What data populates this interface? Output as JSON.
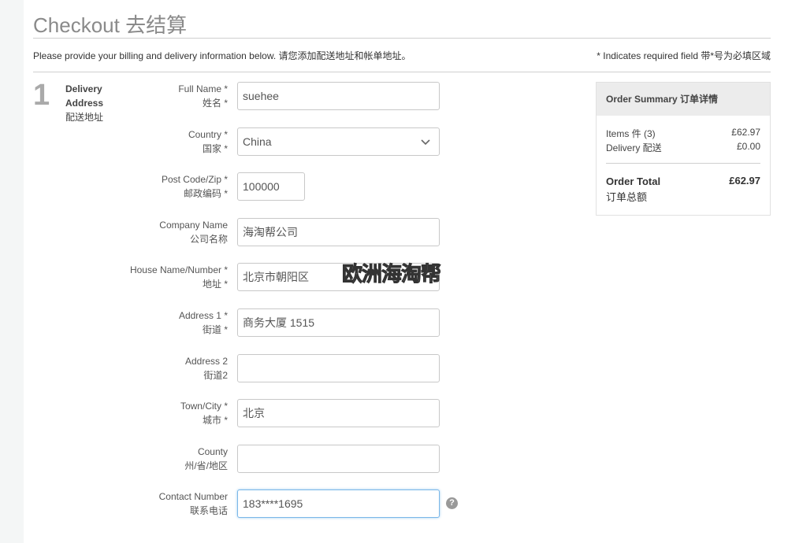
{
  "header": {
    "title": "Checkout 去结算",
    "intro": "Please provide your billing and delivery information below. 请您添加配送地址和帐单地址。",
    "required_note": "* Indicates required field 带*号为必填区域"
  },
  "step": {
    "number": "1",
    "label_en_line1": "Delivery",
    "label_en_line2": "Address",
    "label_zh": "配送地址"
  },
  "form": {
    "full_name": {
      "label_en": "Full Name *",
      "label_zh": "姓名 *",
      "value": "suehee"
    },
    "country": {
      "label_en": "Country *",
      "label_zh": "国家 *",
      "value": "China"
    },
    "post_code": {
      "label_en": "Post Code/Zip *",
      "label_zh": "邮政编码 *",
      "value": "100000"
    },
    "company": {
      "label_en": "Company Name",
      "label_zh": "公司名称",
      "value": "海淘帮公司"
    },
    "house": {
      "label_en": "House Name/Number *",
      "label_zh": "地址 *",
      "value": "北京市朝阳区"
    },
    "address1": {
      "label_en": "Address 1 *",
      "label_zh": "街道 *",
      "value": "商务大厦 1515"
    },
    "address2": {
      "label_en": "Address 2",
      "label_zh": "街道2",
      "value": ""
    },
    "town": {
      "label_en": "Town/City *",
      "label_zh": "城市 *",
      "value": "北京"
    },
    "county": {
      "label_en": "County",
      "label_zh": "州/省/地区",
      "value": ""
    },
    "contact": {
      "label_en": "Contact Number",
      "label_zh": "联系电话",
      "value": "183****1695"
    },
    "help_glyph": "?"
  },
  "watermark": "欧洲海淘帮",
  "summary": {
    "title": "Order Summary 订单详情",
    "items_label": "Items 件 (3)",
    "items_amount": "£62.97",
    "delivery_label": "Delivery 配送",
    "delivery_amount": "£0.00",
    "total_label_en": "Order Total",
    "total_label_zh": "订单总额",
    "total_amount": "£62.97"
  }
}
